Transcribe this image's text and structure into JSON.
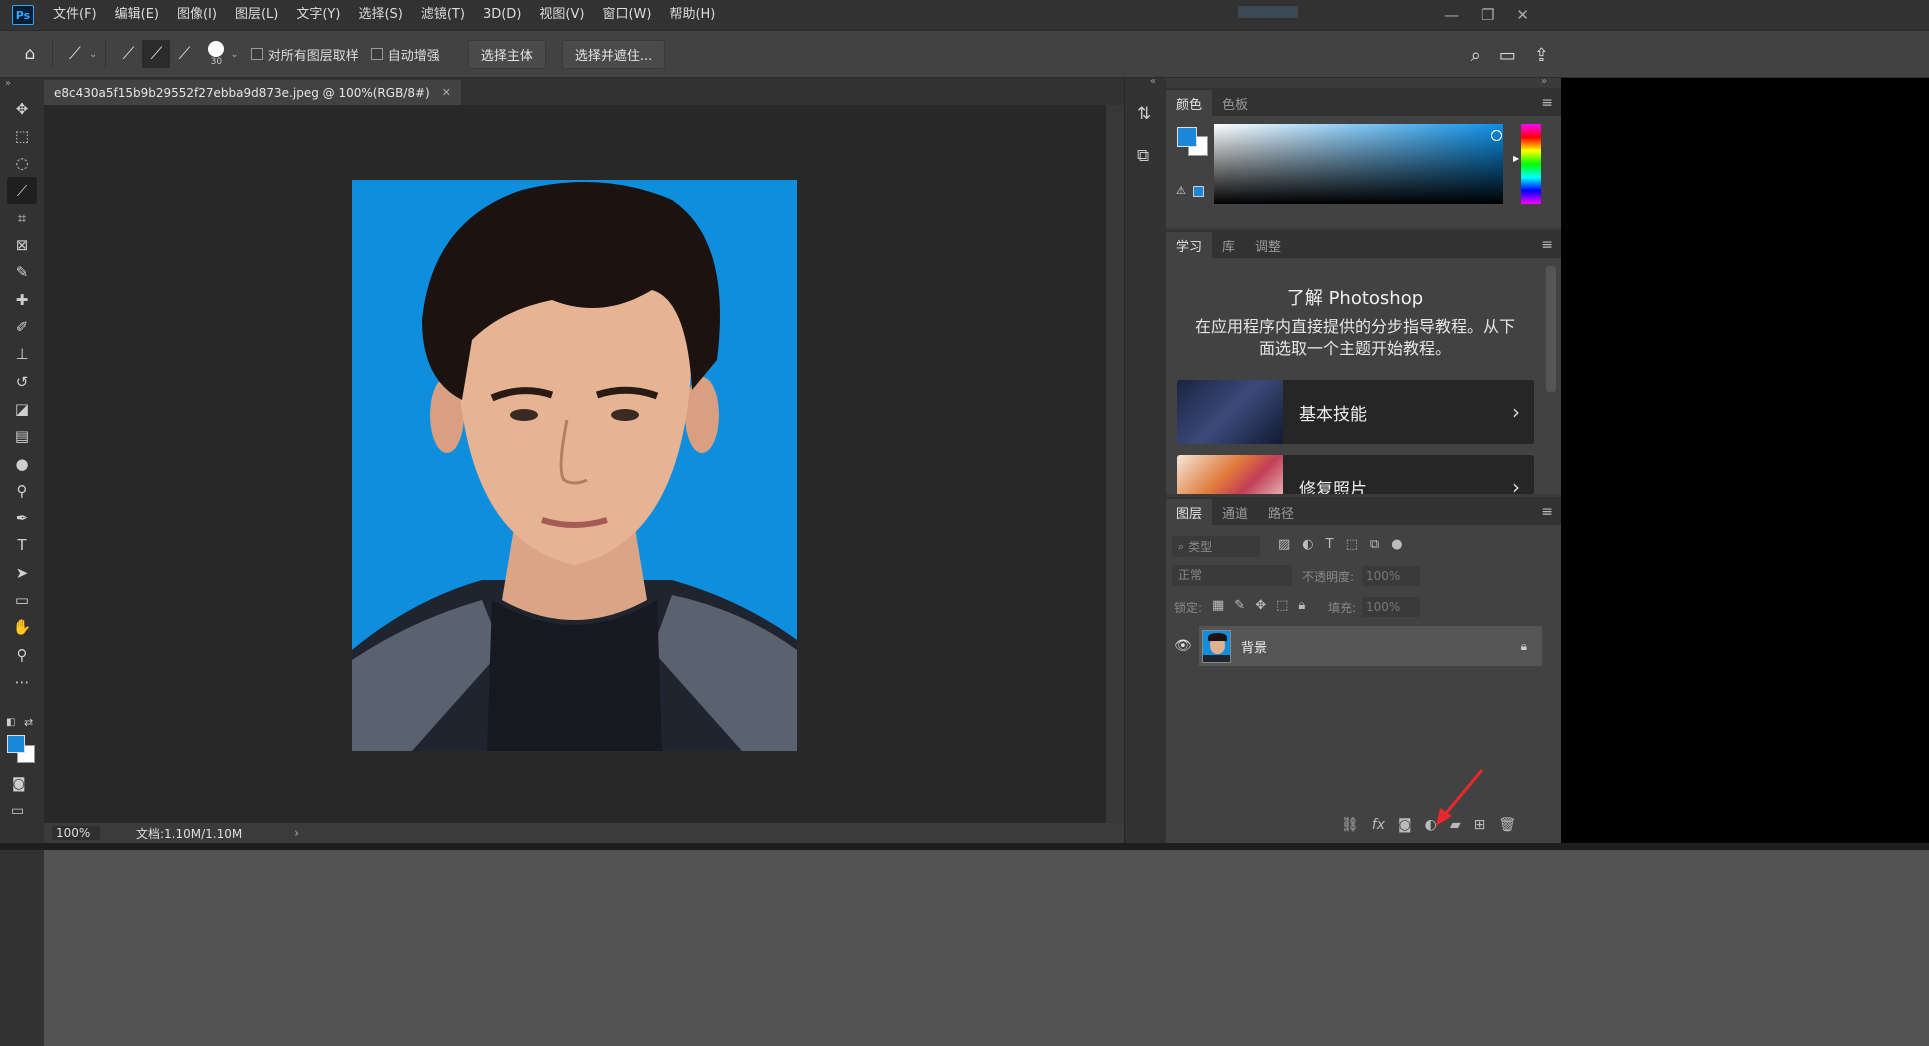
{
  "app": {
    "logo": "Ps"
  },
  "menu": [
    "文件(F)",
    "编辑(E)",
    "图像(I)",
    "图层(L)",
    "文字(Y)",
    "选择(S)",
    "滤镜(T)",
    "3D(D)",
    "视图(V)",
    "窗口(W)",
    "帮助(H)"
  ],
  "window_controls": {
    "minimize": "—",
    "restore": "❐",
    "close": "✕"
  },
  "options": {
    "brush_size": "30",
    "sample_all_layers": "对所有图层取样",
    "auto_enhance": "自动增强",
    "select_subject": "选择主体",
    "select_and_mask": "选择并遮住..."
  },
  "document": {
    "tab_title": "e8c430a5f15b9b29552f27ebba9d873e.jpeg @ 100%(RGB/8#)",
    "close": "✕",
    "zoom": "100%",
    "doc_size": "文档:1.10M/1.10M",
    "status_arrow": "›"
  },
  "colors": {
    "foreground": "#1a87d8",
    "background": "#ffffff",
    "photo_bg": "#0f8ede"
  },
  "color_panel": {
    "tabs": [
      "颜色",
      "色板"
    ]
  },
  "learn_panel": {
    "tabs": [
      "学习",
      "库",
      "调整"
    ],
    "title": "了解 Photoshop",
    "description": "在应用程序内直接提供的分步指导教程。从下面选取一个主题开始教程。",
    "cards": [
      "基本技能",
      "修复照片"
    ]
  },
  "layers_panel": {
    "tabs": [
      "图层",
      "通道",
      "路径"
    ],
    "filter_placeholder": "类型",
    "blend_mode": "正常",
    "opacity_label": "不透明度:",
    "opacity_value": "100%",
    "lock_label": "锁定:",
    "fill_label": "填充:",
    "fill_value": "100%",
    "layers": [
      {
        "name": "背景",
        "visible": true,
        "locked": true
      }
    ]
  },
  "collapse_left": "»",
  "collapse_right": "«",
  "collapse_right2": "»"
}
